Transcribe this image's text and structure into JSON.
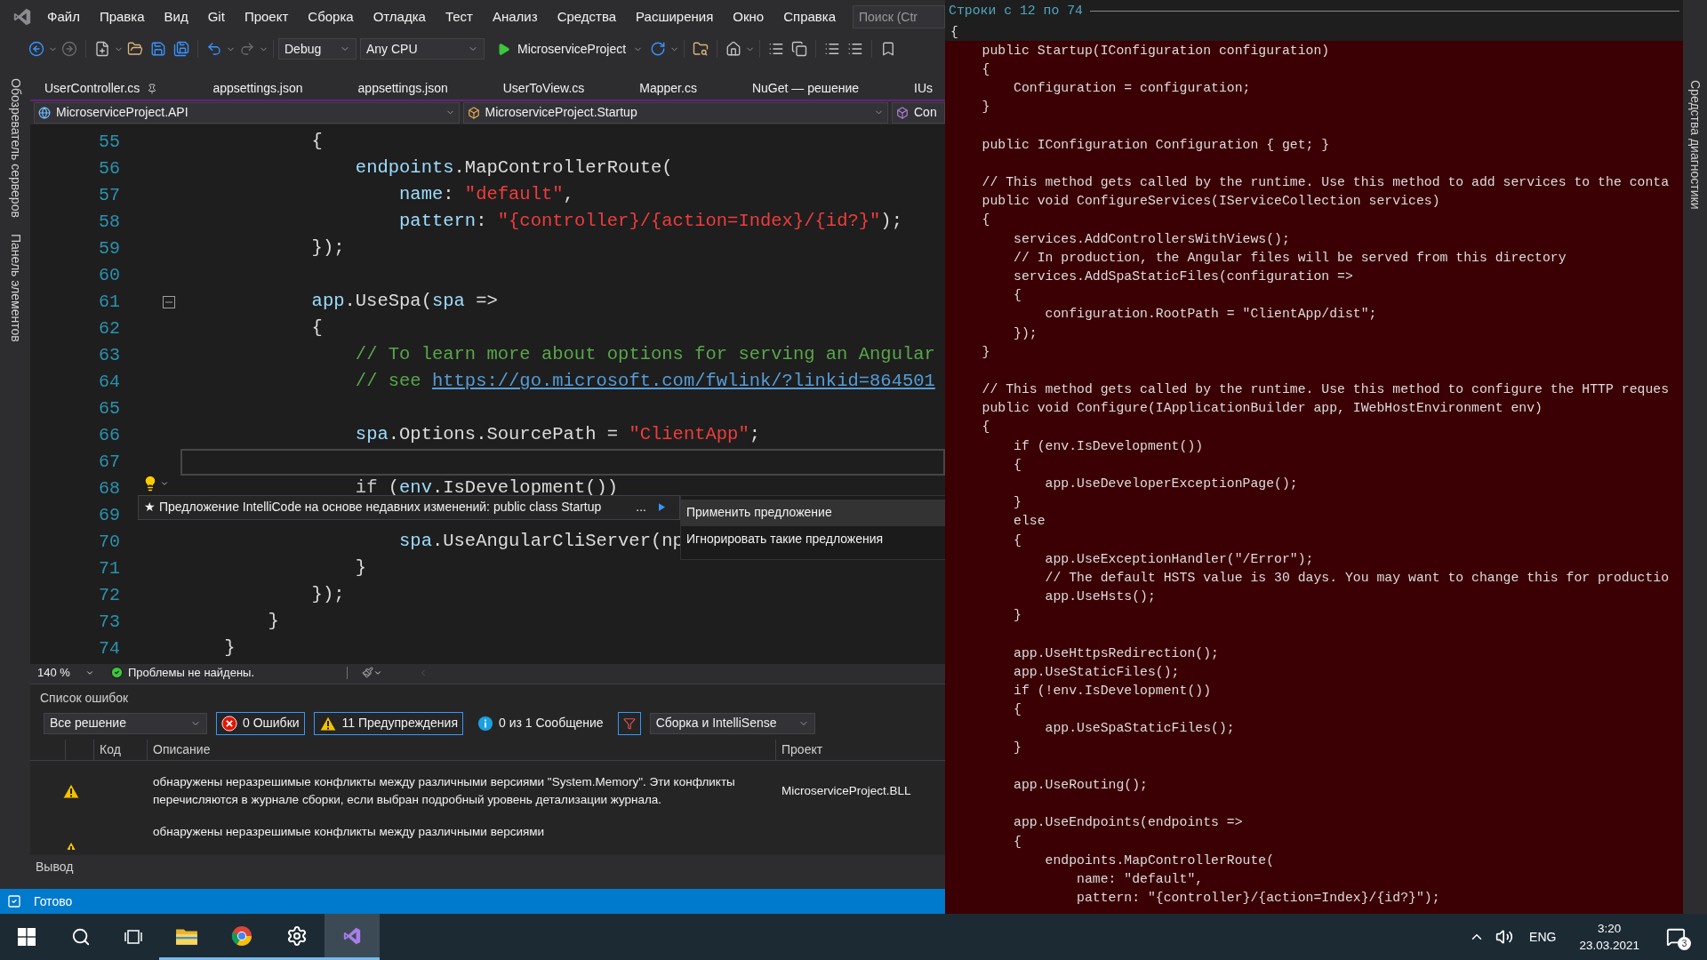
{
  "menu": {
    "items": [
      "Файл",
      "Правка",
      "Вид",
      "Git",
      "Проект",
      "Сборка",
      "Отладка",
      "Тест",
      "Анализ",
      "Средства",
      "Расширения",
      "Окно",
      "Справка"
    ],
    "search": {
      "placeholder": "Поиск (Ctr"
    }
  },
  "toolbar": {
    "configuration": "Debug",
    "platform": "Any CPU",
    "startup_project": "MicroserviceProject"
  },
  "left_panels": [
    "Обозреватель серверов",
    "Панель элементов"
  ],
  "tabs": [
    {
      "label": "UserController.cs",
      "pinned": true,
      "selected": false
    },
    {
      "label": "appsettings.json",
      "pinned": false,
      "selected": false
    },
    {
      "label": "appsettings.json",
      "pinned": false,
      "selected": false
    },
    {
      "label": "UserToView.cs",
      "pinned": false,
      "selected": false
    },
    {
      "label": "Mapper.cs",
      "pinned": false,
      "selected": false
    },
    {
      "label": "NuGet — решение",
      "pinned": false,
      "selected": false
    },
    {
      "label": "IUs",
      "pinned": false,
      "selected": false
    }
  ],
  "nav_bar": {
    "project": "MicroserviceProject.API",
    "type": "MicroserviceProject.Startup",
    "member": "Con"
  },
  "editor": {
    "lines": [
      {
        "number": "55",
        "current": false,
        "fold": false,
        "tokens": [
          {
            "kind": "plain",
            "text": "            {"
          }
        ]
      },
      {
        "number": "56",
        "current": false,
        "fold": false,
        "tokens": [
          {
            "kind": "ident",
            "text": "                endpoints"
          },
          {
            "kind": "plain",
            "text": ".MapControllerRoute("
          }
        ]
      },
      {
        "number": "57",
        "current": false,
        "fold": false,
        "tokens": [
          {
            "kind": "ident",
            "text": "                    name"
          },
          {
            "kind": "plain",
            "text": ": "
          },
          {
            "kind": "string",
            "text": "\"default\""
          },
          {
            "kind": "plain",
            "text": ","
          }
        ]
      },
      {
        "number": "58",
        "current": false,
        "fold": false,
        "tokens": [
          {
            "kind": "ident",
            "text": "                    pattern"
          },
          {
            "kind": "plain",
            "text": ": "
          },
          {
            "kind": "string",
            "text": "\"{controller}/{action=Index}/{id?}\""
          },
          {
            "kind": "plain",
            "text": ");"
          }
        ]
      },
      {
        "number": "59",
        "current": false,
        "fold": false,
        "tokens": [
          {
            "kind": "plain",
            "text": "            });"
          }
        ]
      },
      {
        "number": "60",
        "current": false,
        "fold": false
      },
      {
        "number": "61",
        "current": false,
        "fold": true,
        "tokens": [
          {
            "kind": "ident",
            "text": "            app"
          },
          {
            "kind": "plain",
            "text": ".UseSpa("
          },
          {
            "kind": "ident",
            "text": "spa"
          },
          {
            "kind": "plain",
            "text": " =>"
          }
        ]
      },
      {
        "number": "62",
        "current": false,
        "fold": false,
        "tokens": [
          {
            "kind": "plain",
            "text": "            {"
          }
        ]
      },
      {
        "number": "63",
        "current": false,
        "fold": false,
        "tokens": [
          {
            "kind": "comment",
            "text": "                // To learn more about options for serving an Angular"
          }
        ]
      },
      {
        "number": "64",
        "current": false,
        "fold": false,
        "tokens": [
          {
            "kind": "comment",
            "text": "                // see "
          },
          {
            "kind": "link",
            "text": "https://go.microsoft.com/fwlink/?linkid=864501"
          }
        ]
      },
      {
        "number": "65",
        "current": false,
        "fold": false
      },
      {
        "number": "66",
        "current": false,
        "fold": false,
        "tokens": [
          {
            "kind": "ident",
            "text": "                spa"
          },
          {
            "kind": "plain",
            "text": ".Options.SourcePath = "
          },
          {
            "kind": "string",
            "text": "\"ClientApp\""
          },
          {
            "kind": "plain",
            "text": ";"
          }
        ]
      },
      {
        "number": "67",
        "current": true,
        "fold": false
      },
      {
        "number": "68",
        "current": false,
        "fold": false,
        "tokens": [
          {
            "kind": "keyword",
            "text": "                if"
          },
          {
            "kind": "plain",
            "text": " ("
          },
          {
            "kind": "ident",
            "text": "env"
          },
          {
            "kind": "plain",
            "text": ".IsDevelopment())"
          }
        ]
      },
      {
        "number": "69",
        "current": false,
        "fold": false
      },
      {
        "number": "70",
        "current": false,
        "fold": false,
        "tokens": [
          {
            "kind": "ident",
            "text": "                    spa"
          },
          {
            "kind": "plain",
            "text": ".UseAngularCliServer(np"
          }
        ]
      },
      {
        "number": "71",
        "current": false,
        "fold": false,
        "tokens": [
          {
            "kind": "plain",
            "text": "                }"
          }
        ]
      },
      {
        "number": "72",
        "current": false,
        "fold": false,
        "tokens": [
          {
            "kind": "plain",
            "text": "            });"
          }
        ]
      },
      {
        "number": "73",
        "current": false,
        "fold": false,
        "tokens": [
          {
            "kind": "plain",
            "text": "        }"
          }
        ]
      },
      {
        "number": "74",
        "current": false,
        "fold": false,
        "tokens": [
          {
            "kind": "plain",
            "text": "    }"
          }
        ]
      }
    ]
  },
  "suggestion": {
    "star": "★",
    "text": "Предложение IntelliCode на основе недавних изменений: public class Startup",
    "more": "...",
    "actions": [
      {
        "label": "Применить предложение",
        "selected": true
      },
      {
        "label": "Игнорировать такие предложения",
        "selected": false
      }
    ]
  },
  "editor_status": {
    "zoom": "140 %",
    "message": "Проблемы не найдены."
  },
  "error_list": {
    "title": "Список ошибок",
    "scope": "Все решение",
    "filters": [
      {
        "kind": "error",
        "label": "0 Ошибки",
        "on": true
      },
      {
        "kind": "warning",
        "label": "11 Предупреждения",
        "on": true
      },
      {
        "kind": "info",
        "label": "0 из 1 Сообщение",
        "on": false
      }
    ],
    "source": "Сборка и IntelliSense",
    "columns": [
      "Код",
      "Описание",
      "Проект"
    ],
    "rows": [
      {
        "kind": "warning",
        "description": "обнаружены неразрешимые конфликты между различными версиями \"System.Memory\". Эти конфликты перечисляются в журнале сборки, если выбран подробный уровень детализации журнала.",
        "project": "MicroserviceProject.BLL"
      },
      {
        "kind": "warning",
        "description": "обнаружены неразрешимые конфликты между различными версиями"
      }
    ]
  },
  "bottom_tabs": [
    "Вывод"
  ],
  "status_bar": {
    "text": "Готово"
  },
  "peek": {
    "title": "Строки с 12 по 74",
    "lines": [
      {
        "highlighted": false,
        "text": "{"
      },
      {
        "highlighted": true,
        "text": "    public Startup(IConfiguration configuration)"
      },
      {
        "highlighted": true,
        "text": "    {"
      },
      {
        "highlighted": true,
        "text": "        Configuration = configuration;"
      },
      {
        "highlighted": true,
        "text": "    }"
      },
      {
        "highlighted": true
      },
      {
        "highlighted": true,
        "text": "    public IConfiguration Configuration { get; }"
      },
      {
        "highlighted": true
      },
      {
        "highlighted": true,
        "text": "    // This method gets called by the runtime. Use this method to add services to the conta"
      },
      {
        "highlighted": true,
        "text": "    public void ConfigureServices(IServiceCollection services)"
      },
      {
        "highlighted": true,
        "text": "    {"
      },
      {
        "highlighted": true,
        "text": "        services.AddControllersWithViews();"
      },
      {
        "highlighted": true,
        "text": "        // In production, the Angular files will be served from this directory"
      },
      {
        "highlighted": true,
        "text": "        services.AddSpaStaticFiles(configuration =>"
      },
      {
        "highlighted": true,
        "text": "        {"
      },
      {
        "highlighted": true,
        "text": "            configuration.RootPath = \"ClientApp/dist\";"
      },
      {
        "highlighted": true,
        "text": "        });"
      },
      {
        "highlighted": true,
        "text": "    }"
      },
      {
        "highlighted": true
      },
      {
        "highlighted": true,
        "text": "    // This method gets called by the runtime. Use this method to configure the HTTP reques"
      },
      {
        "highlighted": true,
        "text": "    public void Configure(IApplicationBuilder app, IWebHostEnvironment env)"
      },
      {
        "highlighted": true,
        "text": "    {"
      },
      {
        "highlighted": true,
        "text": "        if (env.IsDevelopment())"
      },
      {
        "highlighted": true,
        "text": "        {"
      },
      {
        "highlighted": true,
        "text": "            app.UseDeveloperExceptionPage();"
      },
      {
        "highlighted": true,
        "text": "        }"
      },
      {
        "highlighted": true,
        "text": "        else"
      },
      {
        "highlighted": true,
        "text": "        {"
      },
      {
        "highlighted": true,
        "text": "            app.UseExceptionHandler(\"/Error\");"
      },
      {
        "highlighted": true,
        "text": "            // The default HSTS value is 30 days. You may want to change this for productio"
      },
      {
        "highlighted": true,
        "text": "            app.UseHsts();"
      },
      {
        "highlighted": true,
        "text": "        }"
      },
      {
        "highlighted": true
      },
      {
        "highlighted": true,
        "text": "        app.UseHttpsRedirection();"
      },
      {
        "highlighted": true,
        "text": "        app.UseStaticFiles();"
      },
      {
        "highlighted": true,
        "text": "        if (!env.IsDevelopment())"
      },
      {
        "highlighted": true,
        "text": "        {"
      },
      {
        "highlighted": true,
        "text": "            app.UseSpaStaticFiles();"
      },
      {
        "highlighted": true,
        "text": "        }"
      },
      {
        "highlighted": true
      },
      {
        "highlighted": true,
        "text": "        app.UseRouting();"
      },
      {
        "highlighted": true
      },
      {
        "highlighted": true,
        "text": "        app.UseEndpoints(endpoints =>"
      },
      {
        "highlighted": true,
        "text": "        {"
      },
      {
        "highlighted": true,
        "text": "            endpoints.MapControllerRoute("
      },
      {
        "highlighted": true,
        "text": "                name: \"default\","
      },
      {
        "highlighted": true,
        "text": "                pattern: \"{controller}/{action=Index}/{id?}\");"
      }
    ]
  },
  "right_panels": [
    "Средства диагностики"
  ],
  "taskbar": {
    "apps": [
      {
        "kind": "explorer",
        "active": false
      },
      {
        "kind": "browser",
        "active": false
      },
      {
        "kind": "settings",
        "active": false
      },
      {
        "kind": "ide",
        "active": true
      }
    ],
    "language": "ENG",
    "time": "3:20",
    "date": "23.03.2021",
    "notifications": "3"
  }
}
